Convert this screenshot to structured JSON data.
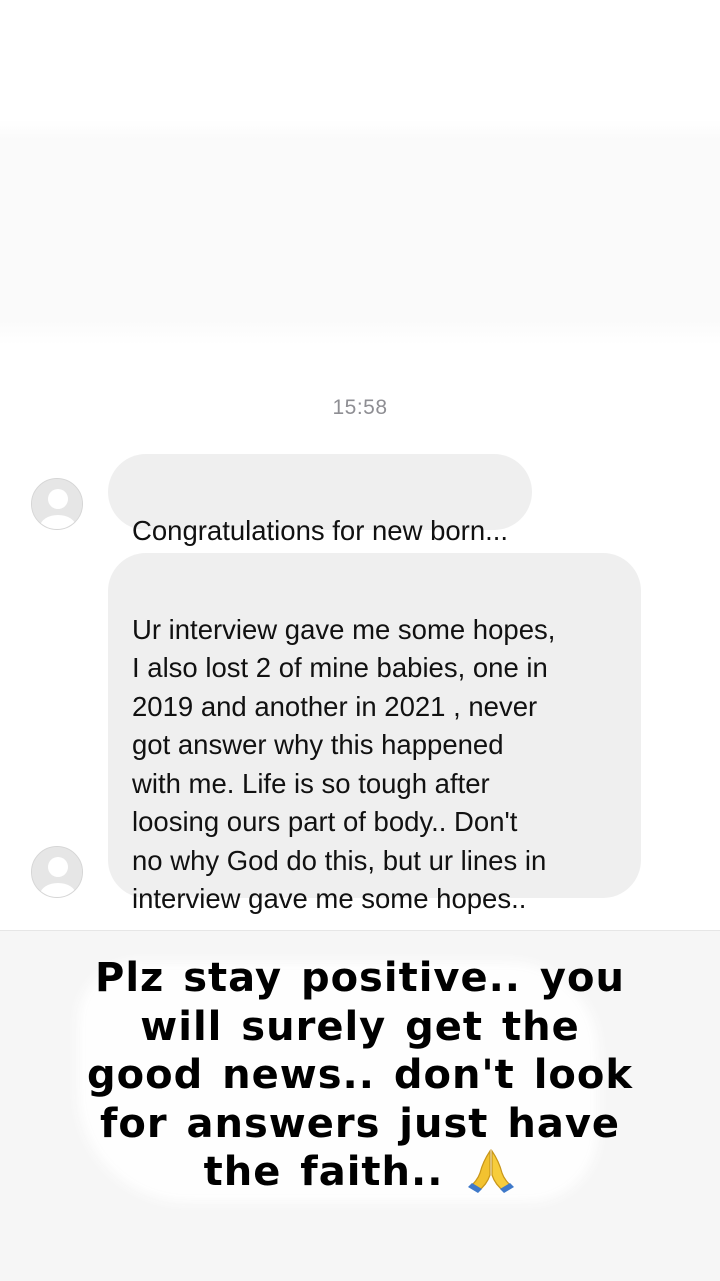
{
  "conversation": {
    "timestamp": "15:58",
    "messages": [
      {
        "text": "Congratulations for new born..."
      },
      {
        "text": "Ur interview gave me some hopes,\nI also lost 2 of mine babies, one in\n2019 and another in 2021 , never\ngot answer why this happened\nwith me. Life is so tough after\nloosing ours part of body.. Don't\nno why God do this, but ur lines in\ninterview gave me some hopes.."
      }
    ]
  },
  "story_caption": {
    "text": "Plz stay positive.. you\nwill surely get the\ngood news.. don't look\nfor answers just have\nthe faith..",
    "icon": "folded-hands-icon"
  },
  "colors": {
    "bubble": "#efefef",
    "timestamp": "#8e8e93",
    "avatar": "#e4e4e4"
  }
}
